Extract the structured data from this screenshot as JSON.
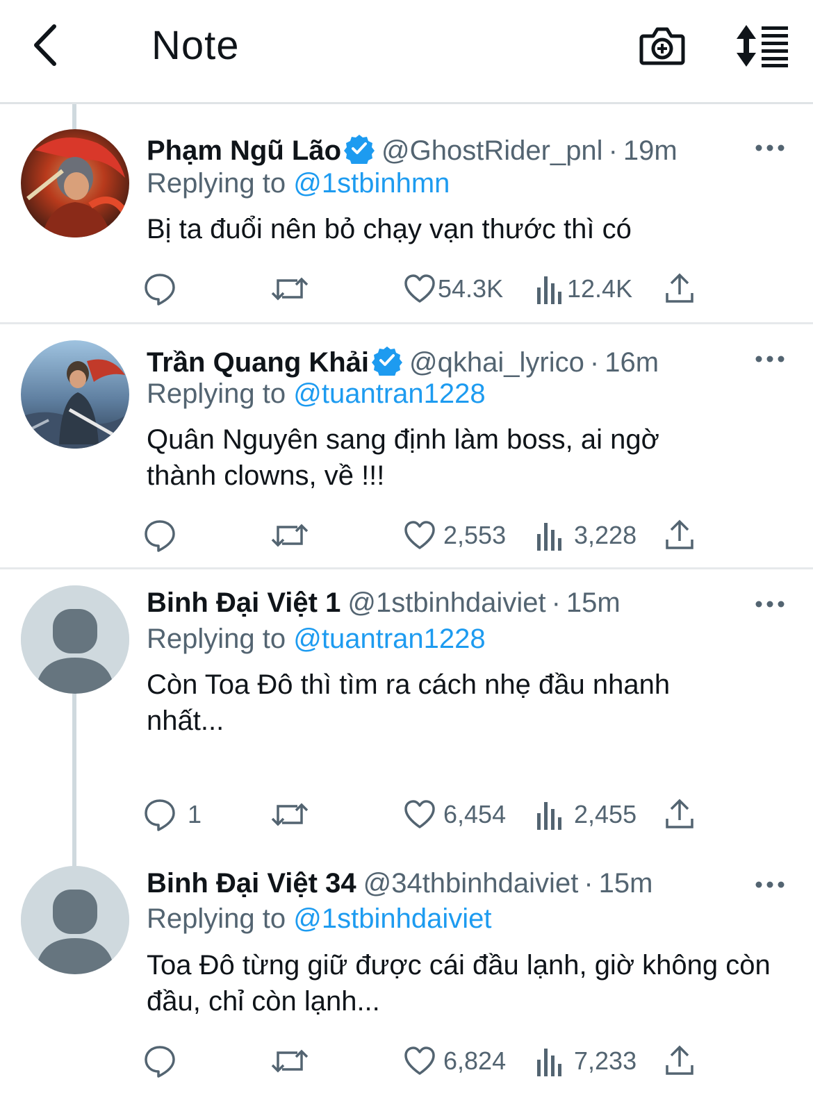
{
  "header": {
    "title": "Note",
    "back_icon": "chevron-left-icon",
    "camera_icon": "camera-add-icon",
    "sort_icon": "sort-list-icon"
  },
  "colors": {
    "link": "#1d9bf0",
    "verified": "#1d9bf0",
    "secondary_text": "#536471",
    "thread_line": "#cfd9de"
  },
  "tweets": [
    {
      "name": "Phạm Ngũ Lão",
      "verified": true,
      "handle": "@GhostRider_pnl",
      "dot": "·",
      "time": "19m",
      "replying_label": "Replying to",
      "replying_to": "@1stbinhmn",
      "text": "Bị ta đuổi nên bỏ chạy vạn thước thì có",
      "replies": "",
      "likes": "54.3K",
      "views": "12.4K",
      "avatar": "warrior-red-avatar"
    },
    {
      "name": "Trần Quang Khải",
      "verified": true,
      "handle": "@qkhai_lyrico",
      "dot": "·",
      "time": "16m",
      "replying_label": "Replying to",
      "replying_to": "@tuantran1228",
      "text": "Quân Nguyên sang định làm boss, ai ngờ thành clowns, về !!!",
      "replies": "",
      "likes": "2,553",
      "views": "3,228",
      "avatar": "general-sword-avatar"
    },
    {
      "name": "Binh Đại Việt 1",
      "verified": false,
      "handle": "@1stbinhdaiviet",
      "dot": "·",
      "time": "15m",
      "replying_label": "Replying to",
      "replying_to": "@tuantran1228",
      "text": "Còn Toa Đô thì tìm ra cách nhẹ đầu nhanh nhất...",
      "replies": "1",
      "likes": "6,454",
      "views": "2,455",
      "avatar": "default-avatar"
    },
    {
      "name": "Binh Đại Việt 34",
      "verified": false,
      "handle": "@34thbinhdaiviet",
      "dot": "·",
      "time": "15m",
      "replying_label": "Replying to",
      "replying_to": "@1stbinhdaiviet",
      "text": "Toa Đô từng giữ được cái đầu lạnh, giờ không còn đầu, chỉ còn lạnh...",
      "replies": "",
      "likes": "6,824",
      "views": "7,233",
      "avatar": "default-avatar"
    }
  ]
}
